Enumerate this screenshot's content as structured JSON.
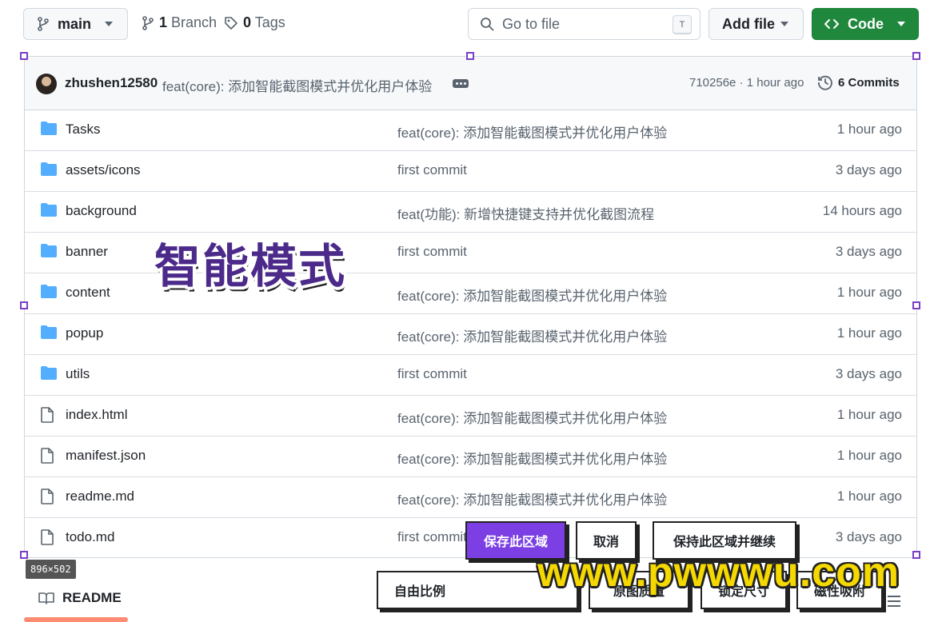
{
  "topbar": {
    "branch_label": "main",
    "branches_count": "1",
    "branches_label": "Branch",
    "tags_count": "0",
    "tags_label": "Tags",
    "search_placeholder": "Go to file",
    "search_kbd": "T",
    "add_file_label": "Add file",
    "code_label": "Code"
  },
  "commit_bar": {
    "author": "zhushen12580",
    "message": "feat(core): 添加智能截图模式并优化用户体验",
    "sha_time": "710256e · 1 hour ago",
    "commits_label": "6 Commits"
  },
  "files": [
    {
      "name": "Tasks",
      "type": "folder",
      "message": "feat(core): 添加智能截图模式并优化用户体验",
      "age": "1 hour ago"
    },
    {
      "name": "assets/icons",
      "type": "folder",
      "message": "first commit",
      "age": "3 days ago"
    },
    {
      "name": "background",
      "type": "folder",
      "message": "feat(功能): 新增快捷键支持并优化截图流程",
      "age": "14 hours ago"
    },
    {
      "name": "banner",
      "type": "folder",
      "message": "first commit",
      "age": "3 days ago"
    },
    {
      "name": "content",
      "type": "folder",
      "message": "feat(core): 添加智能截图模式并优化用户体验",
      "age": "1 hour ago"
    },
    {
      "name": "popup",
      "type": "folder",
      "message": "feat(core): 添加智能截图模式并优化用户体验",
      "age": "1 hour ago"
    },
    {
      "name": "utils",
      "type": "folder",
      "message": "first commit",
      "age": "3 days ago"
    },
    {
      "name": "index.html",
      "type": "file",
      "message": "feat(core): 添加智能截图模式并优化用户体验",
      "age": "1 hour ago"
    },
    {
      "name": "manifest.json",
      "type": "file",
      "message": "feat(core): 添加智能截图模式并优化用户体验",
      "age": "1 hour ago"
    },
    {
      "name": "readme.md",
      "type": "file",
      "message": "feat(core): 添加智能截图模式并优化用户体验",
      "age": "1 hour ago"
    },
    {
      "name": "todo.md",
      "type": "file",
      "message": "first commit",
      "age": "3 days ago"
    }
  ],
  "readme_tab": "README",
  "capture": {
    "mode_title": "智能模式",
    "dimensions": "896×502",
    "save_area": "保存此区域",
    "cancel": "取消",
    "keep_and_continue": "保持此区域并继续",
    "ratio_select": "自由比例",
    "original_quality": "原图质量",
    "lock_size": "锁定尺寸",
    "magnetic_snap": "磁性吸附"
  },
  "watermark": "www.pwwwu.com",
  "colors": {
    "accent_green": "#1f883d",
    "folder_blue": "#54aeff",
    "capture_purple": "#7b3fe4",
    "watermark_yellow": "#f5d800"
  }
}
